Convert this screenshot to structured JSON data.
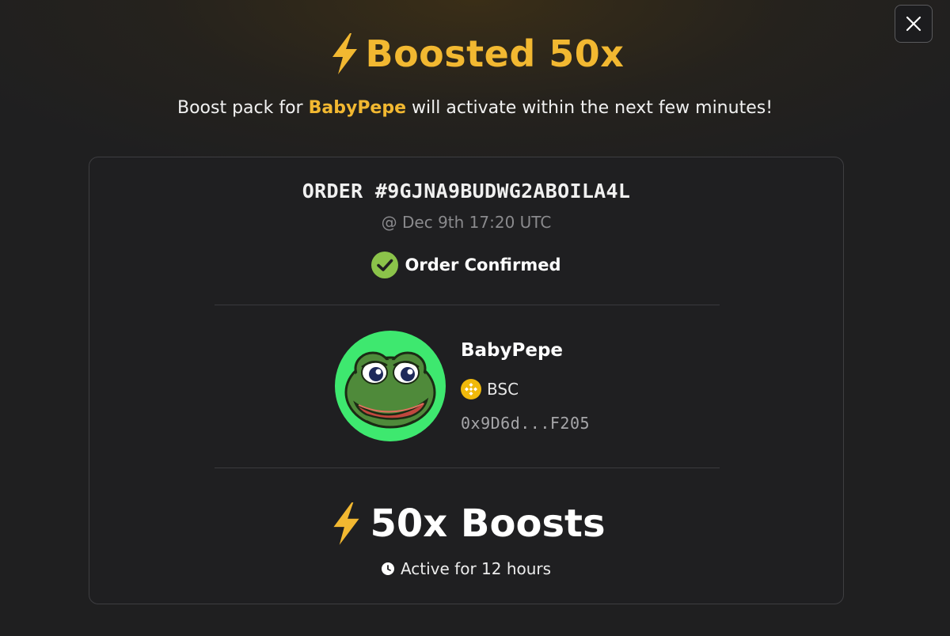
{
  "dialog": {
    "close_icon": "close-icon",
    "title_icon": "lightning-bolt-icon",
    "title": "Boosted 50x",
    "subtitle_prefix": "Boost pack for ",
    "subtitle_token": "BabyPepe",
    "subtitle_suffix": " will activate within the next few minutes!"
  },
  "order": {
    "id_label": "ORDER #9GJNA9BUDWG2ABOILA4L",
    "timestamp": "@ Dec 9th 17:20 UTC",
    "status_icon": "check-circle-icon",
    "status": "Order Confirmed"
  },
  "token": {
    "avatar_icon": "pepe-frog-avatar",
    "name": "BabyPepe",
    "chain_icon": "bnb-chain-icon",
    "chain": "BSC",
    "address": "0x9D6d...F205"
  },
  "boost": {
    "icon": "lightning-bolt-icon",
    "label": "50x Boosts",
    "duration_icon": "clock-icon",
    "duration": "Active for 12 hours"
  },
  "colors": {
    "accent": "#f2b831",
    "success": "#8bc34a",
    "avatar_bg": "#3ee86f",
    "card_border": "#3e3e41"
  }
}
